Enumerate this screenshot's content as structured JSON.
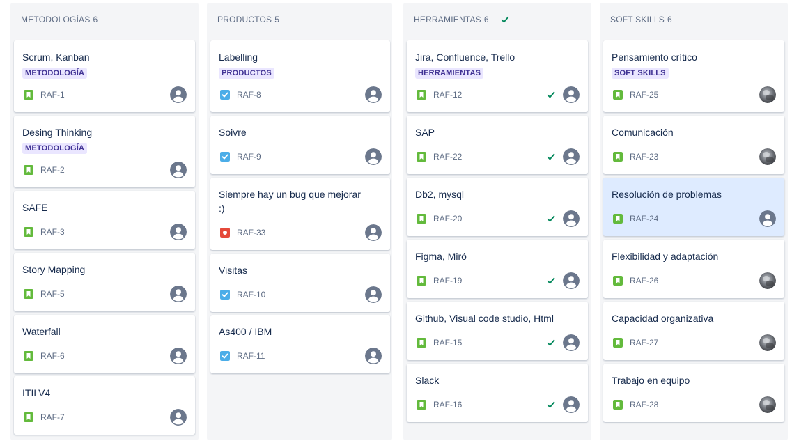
{
  "colors": {
    "story": "#63ba3c",
    "task": "#4bade8",
    "bug": "#e5493a",
    "done_check": "#00875a",
    "epic_bg": "#eae6ff",
    "epic_text": "#403294",
    "selected_card": "#deebff"
  },
  "columns": [
    {
      "title": "METODOLOGÍAS",
      "count": "6",
      "cards": [
        {
          "title": "Scrum, Kanban",
          "epic": "METODOLOGÍA",
          "type": "story-icon",
          "key": "RAF-1",
          "avatar": "default-avatar"
        },
        {
          "title": "Desing Thinking",
          "epic": "METODOLOGÍA",
          "type": "story-icon",
          "key": "RAF-2",
          "avatar": "default-avatar"
        },
        {
          "title": "SAFE",
          "type": "story-icon",
          "key": "RAF-3",
          "avatar": "default-avatar"
        },
        {
          "title": "Story Mapping",
          "type": "story-icon",
          "key": "RAF-5",
          "avatar": "default-avatar"
        },
        {
          "title": "Waterfall",
          "type": "story-icon",
          "key": "RAF-6",
          "avatar": "default-avatar"
        },
        {
          "title": "ITILV4",
          "type": "story-icon",
          "key": "RAF-7",
          "avatar": "default-avatar"
        }
      ]
    },
    {
      "title": "PRODUCTOS",
      "count": "5",
      "cards": [
        {
          "title": "Labelling",
          "epic": "PRODUCTOS",
          "type": "task-icon",
          "key": "RAF-8",
          "avatar": "default-avatar"
        },
        {
          "title": "Soivre",
          "type": "task-icon",
          "key": "RAF-9",
          "avatar": "default-avatar"
        },
        {
          "title": "Siempre hay un bug que mejorar :)",
          "type": "bug-icon",
          "key": "RAF-33",
          "avatar": "default-avatar"
        },
        {
          "title": "Visitas",
          "type": "task-icon",
          "key": "RAF-10",
          "avatar": "default-avatar"
        },
        {
          "title": "As400 / IBM",
          "type": "task-icon",
          "key": "RAF-11",
          "avatar": "default-avatar"
        }
      ]
    },
    {
      "title": "HERRAMIENTAS",
      "count": "6",
      "cards": [
        {
          "title": "Jira, Confluence, Trello",
          "epic": "HERRAMIENTAS",
          "type": "story-icon",
          "key": "RAF-12",
          "avatar": "default-avatar"
        },
        {
          "title": "SAP",
          "type": "story-icon",
          "key": "RAF-22",
          "avatar": "default-avatar"
        },
        {
          "title": "Db2, mysql",
          "type": "story-icon",
          "key": "RAF-20",
          "avatar": "default-avatar"
        },
        {
          "title": "Figma, Miró",
          "type": "story-icon",
          "key": "RAF-19",
          "avatar": "default-avatar"
        },
        {
          "title": "Github, Visual code studio, Html",
          "type": "story-icon",
          "key": "RAF-15",
          "avatar": "default-avatar"
        },
        {
          "title": "Slack",
          "type": "story-icon",
          "key": "RAF-16",
          "avatar": "default-avatar"
        }
      ]
    },
    {
      "title": "SOFT SKILLS",
      "count": "6",
      "cards": [
        {
          "title": "Pensamiento crítico",
          "epic": "SOFT SKILLS",
          "type": "story-icon",
          "key": "RAF-25",
          "avatar": "photo-avatar"
        },
        {
          "title": "Comunicación",
          "type": "story-icon",
          "key": "RAF-23",
          "avatar": "photo-avatar"
        },
        {
          "title": "Resolución de problemas",
          "type": "story-icon",
          "key": "RAF-24",
          "avatar": "default-avatar",
          "selected": true
        },
        {
          "title": "Flexibilidad y adaptación",
          "type": "story-icon",
          "key": "RAF-26",
          "avatar": "photo-avatar"
        },
        {
          "title": "Capacidad organizativa",
          "type": "story-icon",
          "key": "RAF-27",
          "avatar": "photo-avatar"
        },
        {
          "title": "Trabajo en equipo",
          "type": "story-icon",
          "key": "RAF-28",
          "avatar": "photo-avatar"
        }
      ]
    }
  ]
}
